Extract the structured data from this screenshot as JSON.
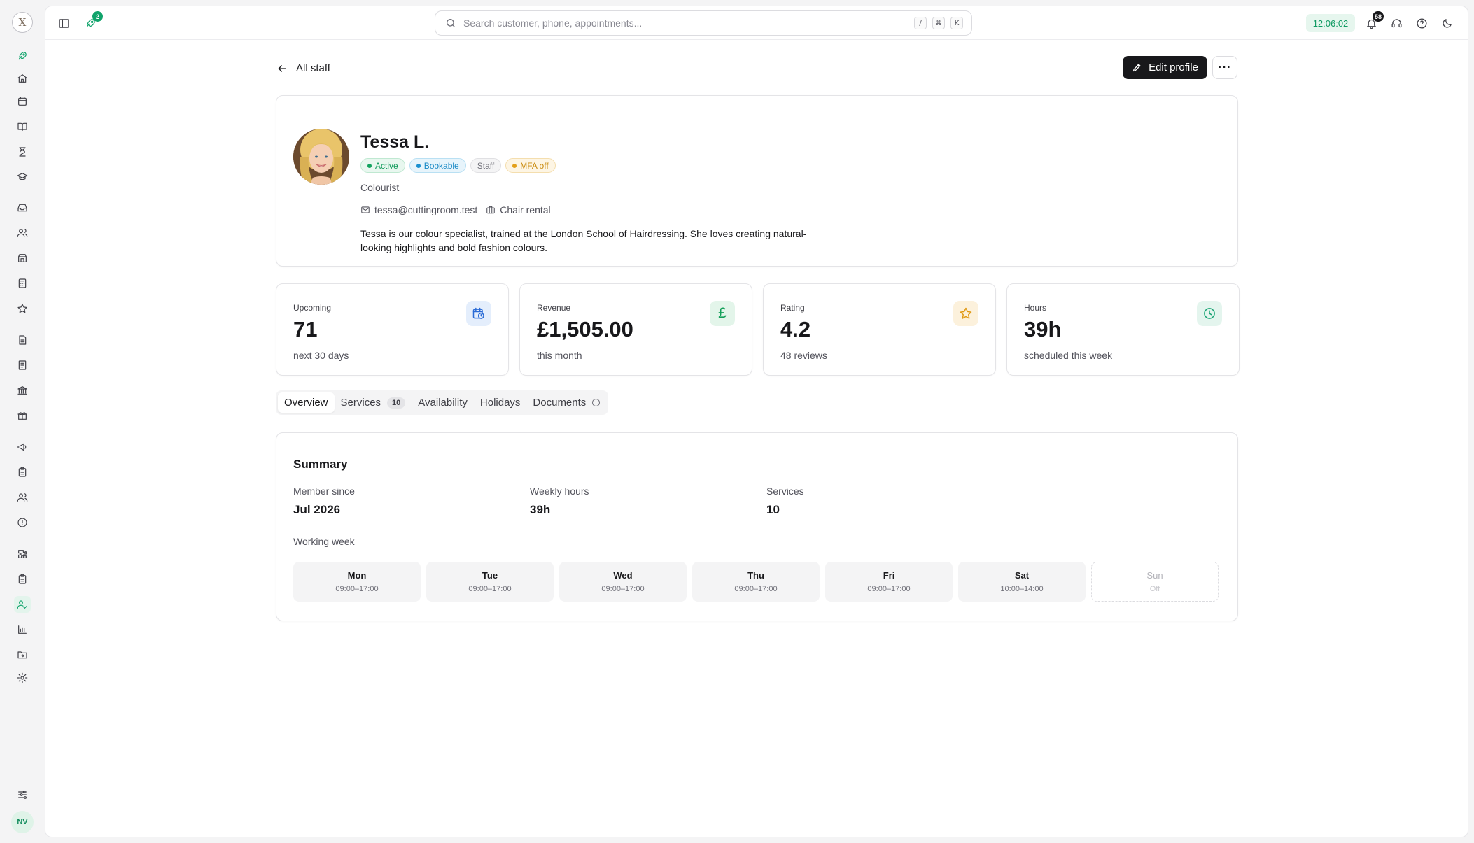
{
  "topbar": {
    "launch_badge": "2",
    "search_placeholder": "Search customer, phone, appointments...",
    "kbd": [
      "/",
      "⌘",
      "K"
    ],
    "clock": "12:06:02",
    "notifications_badge": "58"
  },
  "sidebar": {
    "logo": "X",
    "user_initials": "NV",
    "active_item": "staff"
  },
  "header": {
    "back_label": "All staff",
    "edit_label": "Edit profile",
    "more_label": "···"
  },
  "profile": {
    "name": "Tessa L.",
    "pills": [
      {
        "label": "Active",
        "style": "green"
      },
      {
        "label": "Bookable",
        "style": "blue"
      },
      {
        "label": "Staff",
        "style": "grey"
      },
      {
        "label": "MFA off",
        "style": "amber"
      }
    ],
    "role": "Colourist",
    "email": "tessa@cuttingroom.test",
    "employment": "Chair rental",
    "bio": "Tessa is our colour specialist, trained at the London School of Hairdressing. She loves creating natural-looking highlights and bold fashion colours."
  },
  "stats": [
    {
      "label": "Upcoming",
      "value": "71",
      "sub": "next 30 days",
      "icon": "calendar-clock-icon"
    },
    {
      "label": "Revenue",
      "value": "£1,505.00",
      "sub": "this month",
      "icon": "pound-icon",
      "glyph": "£"
    },
    {
      "label": "Rating",
      "value": "4.2",
      "sub": "48 reviews",
      "icon": "star-icon"
    },
    {
      "label": "Hours",
      "value": "39h",
      "sub": "scheduled this week",
      "icon": "clock-icon"
    }
  ],
  "tabs": {
    "overview": "Overview",
    "services": "Services",
    "services_count": "10",
    "availability": "Availability",
    "holidays": "Holidays",
    "documents": "Documents"
  },
  "summary": {
    "title": "Summary",
    "member_since_label": "Member since",
    "member_since": "Jul 2026",
    "weekly_hours_label": "Weekly hours",
    "weekly_hours": "39h",
    "services_label": "Services",
    "services": "10",
    "working_week_label": "Working week",
    "days": [
      {
        "day": "Mon",
        "hours": "09:00–17:00"
      },
      {
        "day": "Tue",
        "hours": "09:00–17:00"
      },
      {
        "day": "Wed",
        "hours": "09:00–17:00"
      },
      {
        "day": "Thu",
        "hours": "09:00–17:00"
      },
      {
        "day": "Fri",
        "hours": "09:00–17:00"
      },
      {
        "day": "Sat",
        "hours": "10:00–14:00"
      },
      {
        "day": "Sun",
        "hours": "Off"
      }
    ]
  },
  "colors": {
    "accent": "#10a36b",
    "dark": "#18181b"
  }
}
